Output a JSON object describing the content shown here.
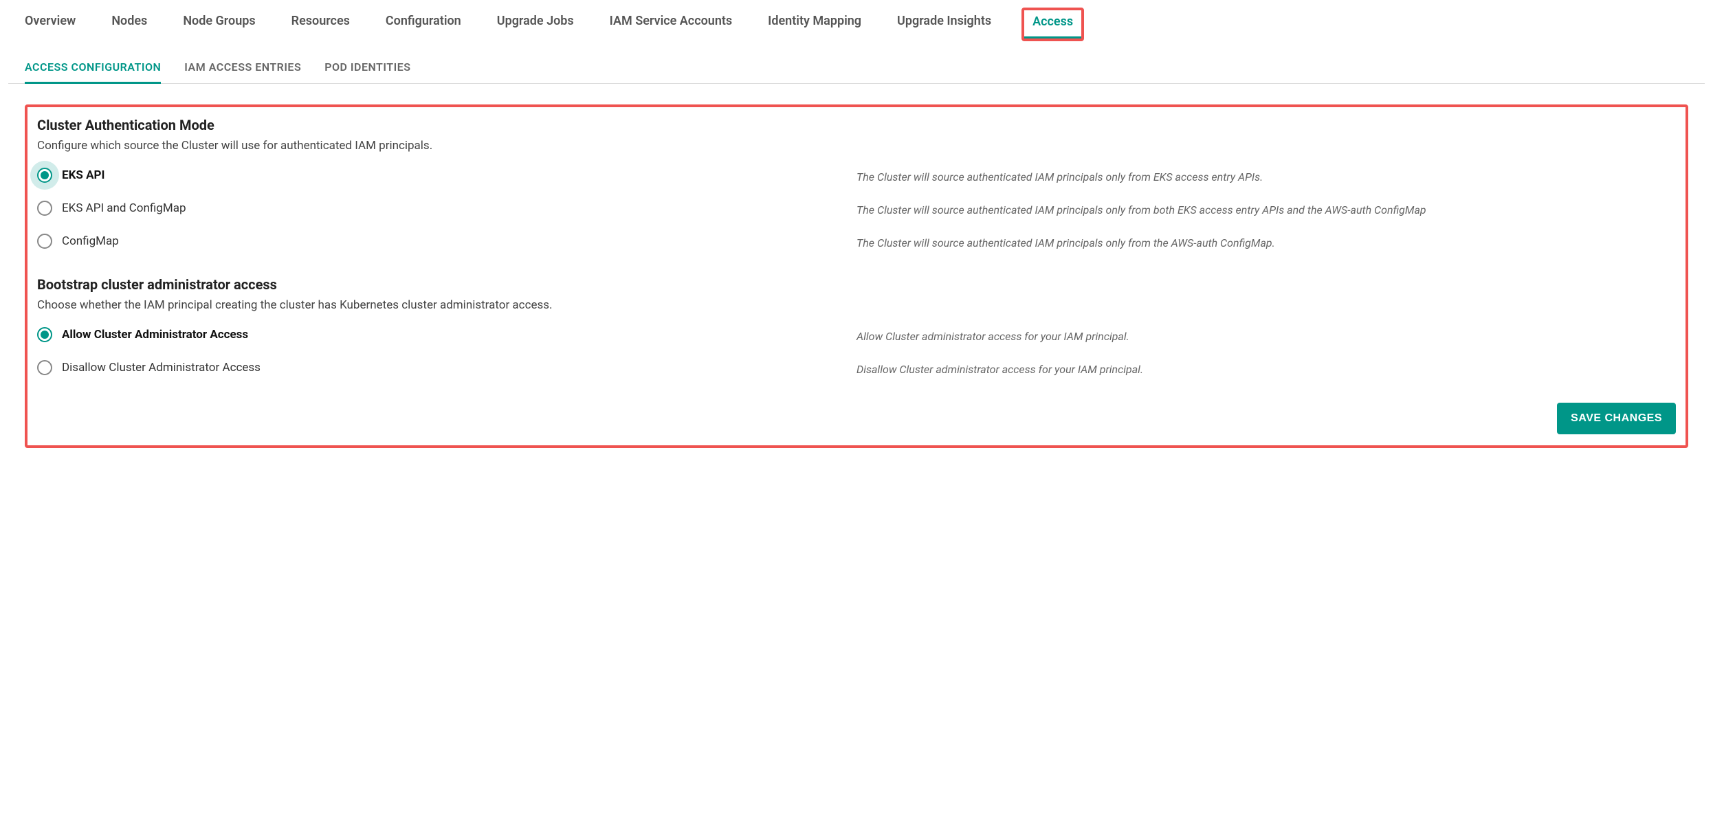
{
  "topTabs": {
    "items": [
      {
        "label": "Overview"
      },
      {
        "label": "Nodes"
      },
      {
        "label": "Node Groups"
      },
      {
        "label": "Resources"
      },
      {
        "label": "Configuration"
      },
      {
        "label": "Upgrade Jobs"
      },
      {
        "label": "IAM Service Accounts"
      },
      {
        "label": "Identity Mapping"
      },
      {
        "label": "Upgrade Insights"
      },
      {
        "label": "Access"
      }
    ],
    "activeIndex": 9
  },
  "subTabs": {
    "items": [
      {
        "label": "ACCESS CONFIGURATION"
      },
      {
        "label": "IAM ACCESS ENTRIES"
      },
      {
        "label": "POD IDENTITIES"
      }
    ],
    "activeIndex": 0
  },
  "authMode": {
    "title": "Cluster Authentication Mode",
    "description": "Configure which source the Cluster will use for authenticated IAM principals.",
    "options": [
      {
        "label": "EKS API",
        "hint": "The Cluster will source authenticated IAM principals only from EKS access entry APIs.",
        "selected": true
      },
      {
        "label": "EKS API and ConfigMap",
        "hint": "The Cluster will source authenticated IAM principals only from both EKS access entry APIs and the AWS-auth ConfigMap",
        "selected": false
      },
      {
        "label": "ConfigMap",
        "hint": "The Cluster will source authenticated IAM principals only from the AWS-auth ConfigMap.",
        "selected": false
      }
    ]
  },
  "bootstrap": {
    "title": "Bootstrap cluster administrator access",
    "description": "Choose whether the IAM principal creating the cluster has Kubernetes cluster administrator access.",
    "options": [
      {
        "label": "Allow Cluster Administrator Access",
        "hint": "Allow Cluster administrator access for your IAM principal.",
        "selected": true
      },
      {
        "label": "Disallow Cluster Administrator Access",
        "hint": "Disallow Cluster administrator access for your IAM principal.",
        "selected": false
      }
    ]
  },
  "buttons": {
    "save": "SAVE CHANGES"
  }
}
